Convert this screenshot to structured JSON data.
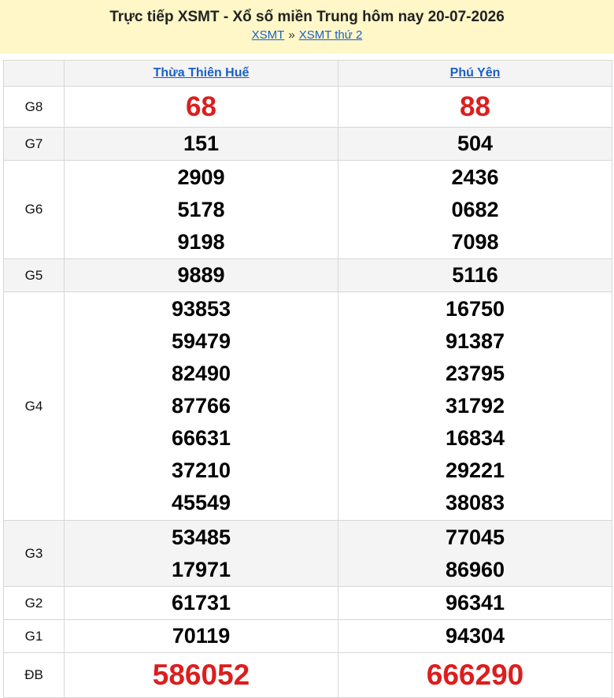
{
  "header": {
    "title": "Trực tiếp XSMT - Xổ số miền Trung hôm nay 20-07-2026",
    "breadcrumb": [
      {
        "label": "XSMT"
      },
      {
        "label": "XSMT thứ 2"
      }
    ],
    "separator": "»"
  },
  "provinces": [
    "Thừa Thiên Huế",
    "Phú Yên"
  ],
  "colors": {
    "header_bg": "#fff7c7",
    "link": "#1a5fc7",
    "highlight": "#dc1e1e",
    "row_alt": "#f4f4f4"
  },
  "prizes": [
    {
      "label": "G8",
      "values": [
        [
          "68"
        ],
        [
          "88"
        ]
      ]
    },
    {
      "label": "G7",
      "values": [
        [
          "151"
        ],
        [
          "504"
        ]
      ]
    },
    {
      "label": "G6",
      "values": [
        [
          "2909",
          "5178",
          "9198"
        ],
        [
          "2436",
          "0682",
          "7098"
        ]
      ]
    },
    {
      "label": "G5",
      "values": [
        [
          "9889"
        ],
        [
          "5116"
        ]
      ]
    },
    {
      "label": "G4",
      "values": [
        [
          "93853",
          "59479",
          "82490",
          "87766",
          "66631",
          "37210",
          "45549"
        ],
        [
          "16750",
          "91387",
          "23795",
          "31792",
          "16834",
          "29221",
          "38083"
        ]
      ]
    },
    {
      "label": "G3",
      "values": [
        [
          "53485",
          "17971"
        ],
        [
          "77045",
          "86960"
        ]
      ]
    },
    {
      "label": "G2",
      "values": [
        [
          "61731"
        ],
        [
          "96341"
        ]
      ]
    },
    {
      "label": "G1",
      "values": [
        [
          "70119"
        ],
        [
          "94304"
        ]
      ]
    },
    {
      "label": "ĐB",
      "values": [
        [
          "586052"
        ],
        [
          "666290"
        ]
      ]
    }
  ]
}
